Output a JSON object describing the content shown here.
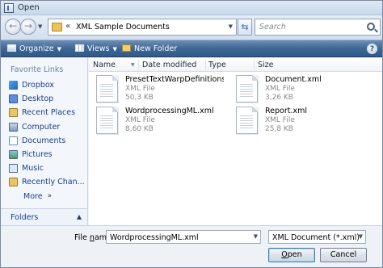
{
  "window": {
    "title": "Open"
  },
  "address": {
    "chevrons": "«",
    "path": "XML Sample Documents",
    "search_placeholder": "Search"
  },
  "toolbar": {
    "organize": "Organize",
    "views": "Views",
    "new_folder": "New Folder",
    "help": "?"
  },
  "sidebar": {
    "header": "Favorite Links",
    "items": [
      {
        "label": "Dropbox",
        "icon": "dropbox-icon"
      },
      {
        "label": "Desktop",
        "icon": "desktop-icon"
      },
      {
        "label": "Recent Places",
        "icon": "recent-places-icon"
      },
      {
        "label": "Computer",
        "icon": "computer-icon"
      },
      {
        "label": "Documents",
        "icon": "documents-icon"
      },
      {
        "label": "Pictures",
        "icon": "pictures-icon"
      },
      {
        "label": "Music",
        "icon": "music-icon"
      },
      {
        "label": "Recently Chan...",
        "icon": "recently-changed-icon"
      }
    ],
    "more": "More",
    "more_chevron": "»",
    "folders": "Folders"
  },
  "columns": [
    "Name",
    "Date modified",
    "Type",
    "Size"
  ],
  "files": [
    {
      "name": "PresetTextWarpDefinitions.x...",
      "type": "XML File",
      "size": "50,3 KB"
    },
    {
      "name": "Document.xml",
      "type": "XML File",
      "size": "3,26 KB"
    },
    {
      "name": "WordprocessingML.xml",
      "type": "XML File",
      "size": "8,60 KB"
    },
    {
      "name": "Report.xml",
      "type": "XML File",
      "size": "25,8 KB"
    }
  ],
  "bottom": {
    "filename_label_prefix": "File ",
    "filename_label_underlined": "n",
    "filename_label_suffix": "ame:",
    "filename_value": "WordprocessingML.xml",
    "filetype_value": "XML Document (*.xml)",
    "open_underlined": "O",
    "open_rest": "pen",
    "cancel": "Cancel"
  },
  "colors": {
    "toolbar": "#3e6795",
    "link": "#1a3e8c",
    "muted": "#8a8a8a"
  }
}
